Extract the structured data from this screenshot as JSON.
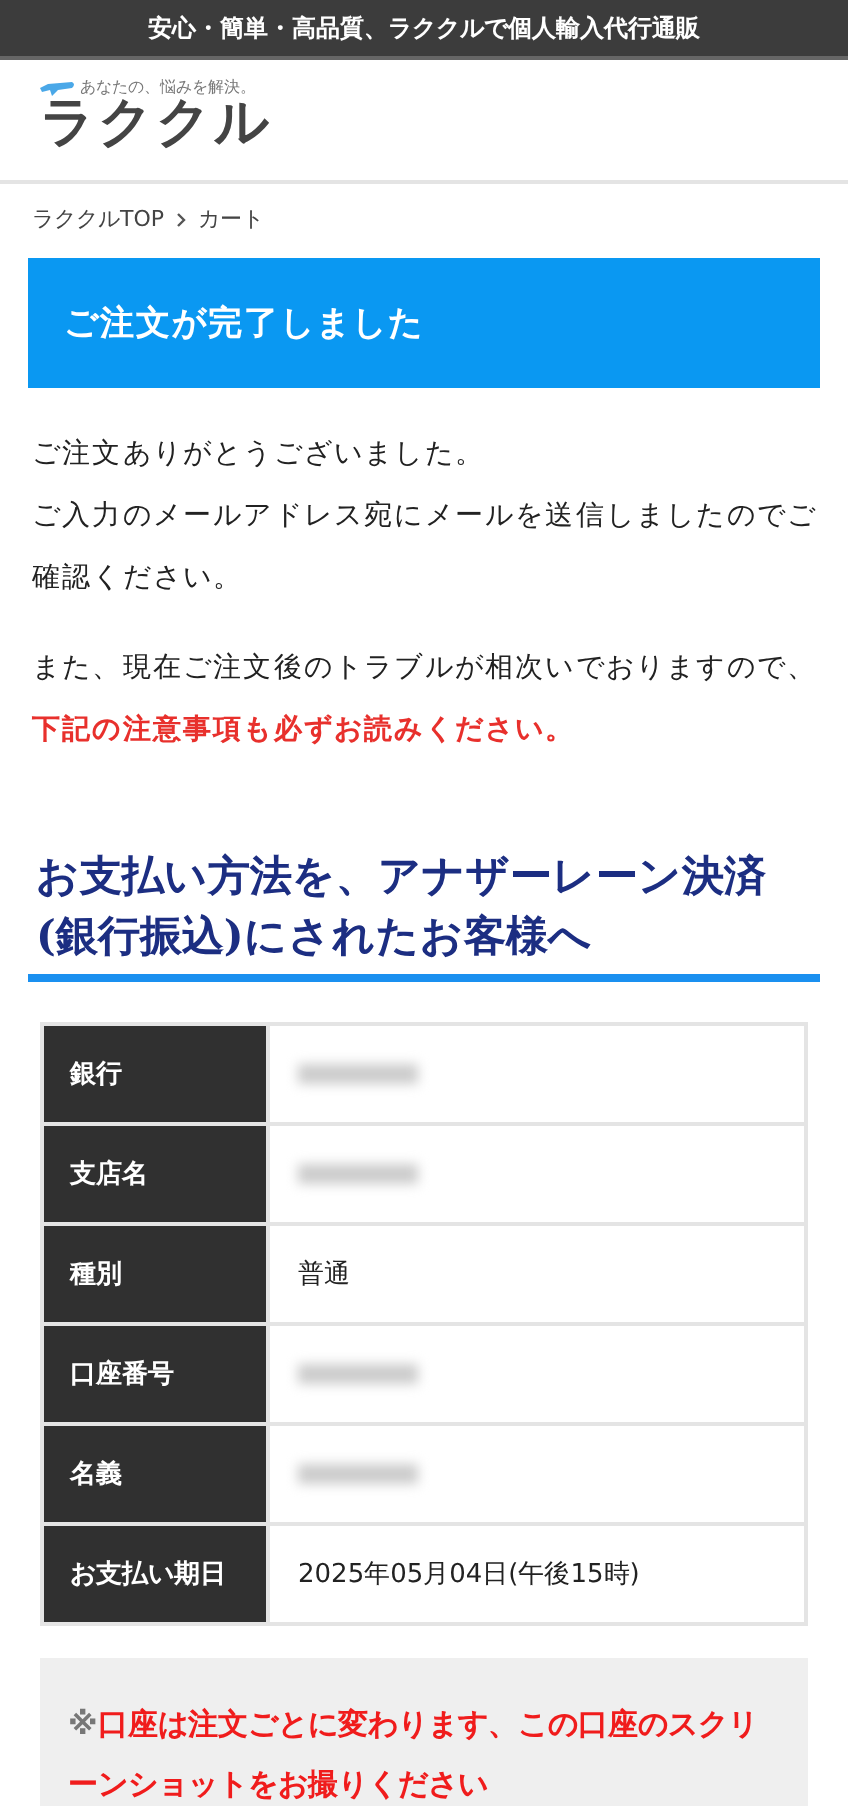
{
  "top_bar": {
    "text": "安心・簡単・高品質、ラククルで個人輸入代行通販"
  },
  "logo": {
    "tagline": "あなたの、悩みを解決。",
    "name": "ラククル"
  },
  "breadcrumb": [
    {
      "label": "ラククルTOP"
    },
    {
      "label": "カート"
    }
  ],
  "banner": {
    "title": "ご注文が完了しました"
  },
  "messages": [
    {
      "lines": [
        "ご注文ありがとうございました。",
        "ご入力のメールアドレス宛にメールを送信しましたのでご確認ください。"
      ]
    },
    {
      "lines": [
        "また、現在ご注文後のトラブルが相次いでおりますので、"
      ],
      "emphasis": "下記の注意事項も必ずお読みください。"
    }
  ],
  "section": {
    "title": "お支払い方法を、アナザーレーン決済(銀行振込)にされたお客様へ"
  },
  "bank_table": [
    {
      "label": "銀行",
      "kind": "redacted"
    },
    {
      "label": "支店名",
      "kind": "redacted"
    },
    {
      "label": "種別",
      "kind": "text",
      "value": "普通"
    },
    {
      "label": "口座番号",
      "kind": "redacted"
    },
    {
      "label": "名義",
      "kind": "redacted"
    },
    {
      "label": "お支払い期日",
      "kind": "text",
      "value": "2025年05月04日(午後15時)"
    }
  ],
  "notice": {
    "mark": "※",
    "text": "口座は注文ごとに変わります、この口座のスクリーンショットをお撮りください"
  }
}
